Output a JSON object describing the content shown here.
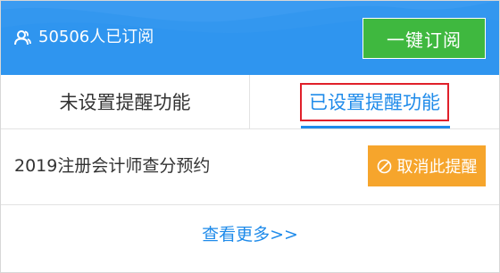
{
  "header": {
    "subscriber_text": "50506人已订阅",
    "subscribe_button": "一键订阅",
    "user_icon": "user-icon",
    "background_color": "#2f95ef",
    "button_color": "#3fb83f"
  },
  "tabs": [
    {
      "label": "未设置提醒功能",
      "active": false
    },
    {
      "label": "已设置提醒功能",
      "active": true
    }
  ],
  "list": {
    "items": [
      {
        "title": "2019注册会计师查分预约",
        "action_label": "取消此提醒",
        "action_icon": "cancel-icon",
        "action_color": "#f6a52c"
      }
    ]
  },
  "footer": {
    "more_link": "查看更多>>"
  },
  "colors": {
    "accent": "#1f8bea",
    "highlight_border": "#e0202a"
  }
}
